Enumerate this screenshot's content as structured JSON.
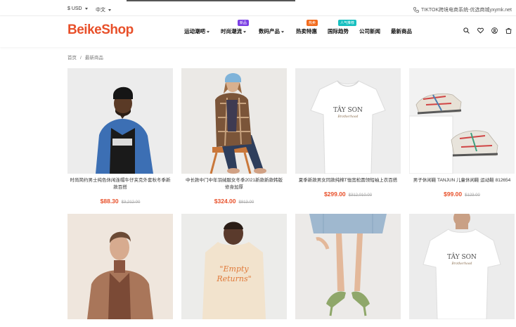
{
  "topbar": {
    "currency": "$ USD",
    "language": "中文",
    "contact": "TIKTOK跨境电商系统-优选商城yxymk.net"
  },
  "header": {
    "logo_b": "B",
    "logo_rest": "eikeShop",
    "nav": [
      {
        "label": "运动潮吧",
        "has_caret": true,
        "badge": ""
      },
      {
        "label": "时尚潮流",
        "has_caret": true,
        "badge": "新品"
      },
      {
        "label": "数码产品",
        "has_caret": true,
        "badge": ""
      },
      {
        "label": "热卖特惠",
        "has_caret": false,
        "badge": "热卖"
      },
      {
        "label": "国际趋势",
        "has_caret": false,
        "badge": "人气推荐"
      },
      {
        "label": "公司新闻",
        "has_caret": false,
        "badge": ""
      },
      {
        "label": "最新商品",
        "has_caret": false,
        "badge": ""
      }
    ],
    "badge_colors": {
      "新品": "#7b3fe4",
      "热卖": "#f26b1d",
      "人气推荐": "#18c0c0"
    },
    "icons": [
      "search-icon",
      "heart-icon",
      "user-icon",
      "cart-icon"
    ]
  },
  "breadcrumb": {
    "home": "首页",
    "current": "最新商品"
  },
  "products": [
    {
      "name": "时尚简约男士纯色休闲连帽牛仔夹克外套秋冬季新款百搭",
      "price": "$88.30",
      "old_price": "$3,212.00"
    },
    {
      "name": "中长款中门中年羽绒服女冬季2021新款新款韩版修身加厚",
      "price": "$324.00",
      "old_price": "$813.00"
    },
    {
      "name": "夏季新款男女同款纯棉T恤宽松圆领短袖上衣百搭",
      "price": "$299.00",
      "old_price": "$312,010.00"
    },
    {
      "name": "男子休闲鞋 TANJUN 儿童休闲鞋 运动鞋 812654",
      "price": "$99.00",
      "old_price": "$123.00"
    },
    {
      "name": "",
      "price": "",
      "old_price": ""
    },
    {
      "name": "",
      "price": "",
      "old_price": ""
    },
    {
      "name": "",
      "price": "",
      "old_price": ""
    },
    {
      "name": "",
      "price": "",
      "old_price": ""
    }
  ],
  "tshirt_print": {
    "line1": "TÂY SON",
    "line2": "Brotherhood"
  },
  "empty_print": {
    "line1": "\"Empty",
    "line2": "Returns\""
  }
}
